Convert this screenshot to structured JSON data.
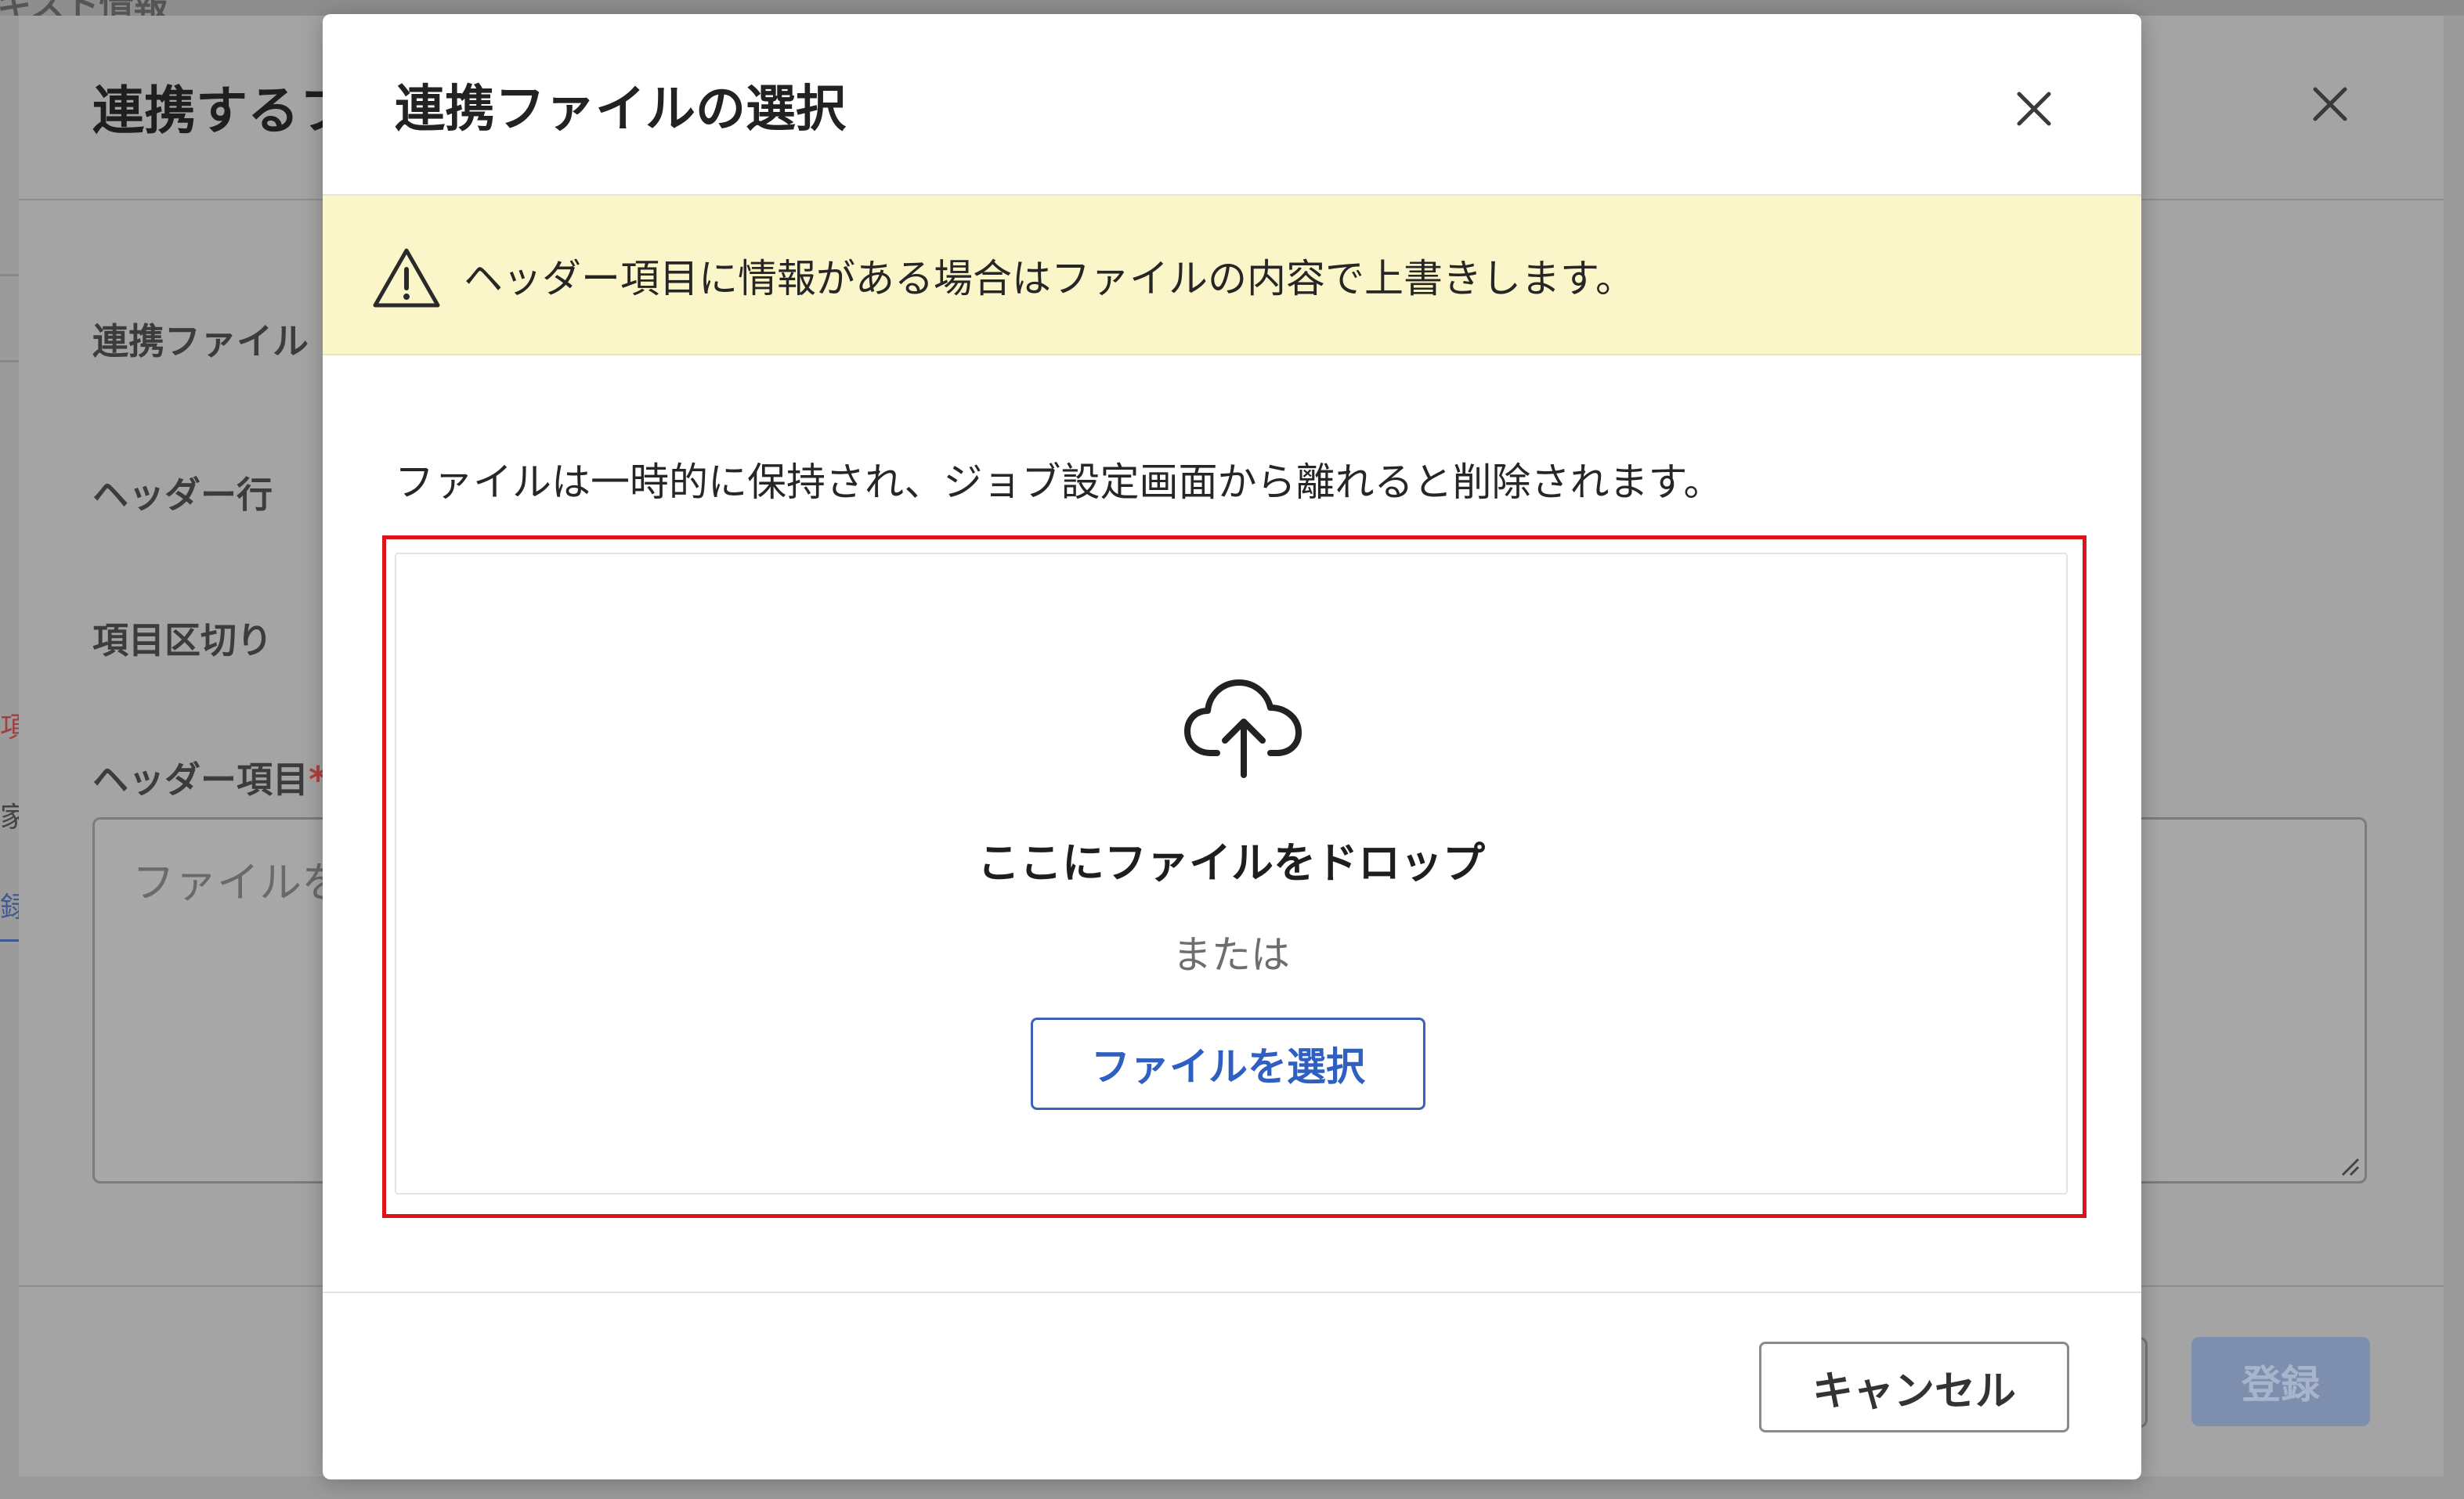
{
  "background": {
    "top_strip_text": "キスト情報",
    "dialog_title": "連携するファイル",
    "labels": {
      "linked_file": "連携ファイル",
      "header_row": "ヘッダー行",
      "item_delimiter": "項目区切り",
      "header_items": "ヘッダー項目",
      "required_mark": "*"
    },
    "left_stub": {
      "red_text": "項",
      "text": "家",
      "blue_text": "録"
    },
    "textarea_placeholder": "ファイルを",
    "register_button": "登録"
  },
  "modal": {
    "title": "連携ファイルの選択",
    "warning": "ヘッダー項目に情報がある場合はファイルの内容で上書きします。",
    "info": "ファイルは一時的に保持され、ジョブ設定画面から離れると削除されます。",
    "dropzone": {
      "drop_text": "ここにファイルをドロップ",
      "or_text": "または",
      "select_button": "ファイルを選択"
    },
    "cancel_button": "キャンセル"
  },
  "colors": {
    "warning_bg": "#fbf6c9",
    "highlight_border": "#e0121a",
    "primary_blue": "#2f5fc0",
    "register_disabled": "#7e8eae"
  },
  "icons": {
    "close": "close-icon",
    "warning": "warning-triangle-icon",
    "upload": "cloud-upload-icon"
  }
}
